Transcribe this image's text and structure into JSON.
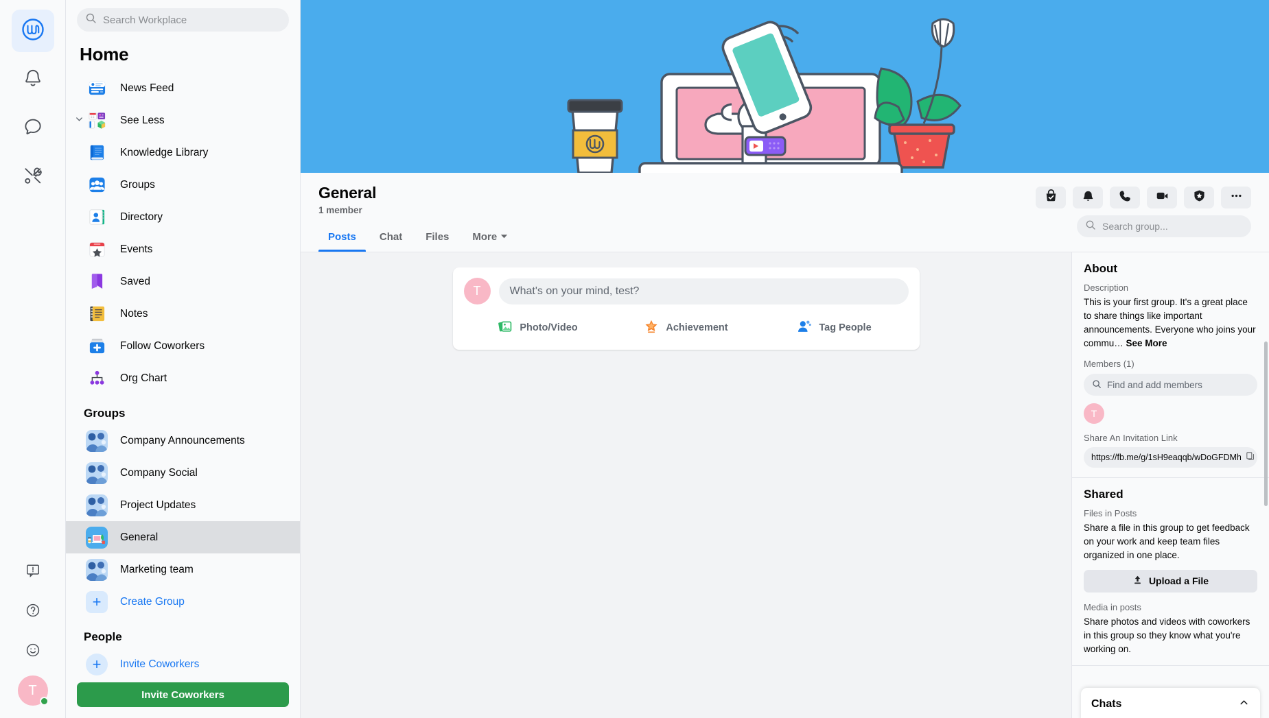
{
  "rail": {
    "items": [
      {
        "name": "workplace-home",
        "icon": "workplace-logo",
        "active": true
      },
      {
        "name": "notifications",
        "icon": "bell-icon",
        "active": false
      },
      {
        "name": "chat",
        "icon": "chat-bubble-icon",
        "active": false
      },
      {
        "name": "tools",
        "icon": "tools-icon",
        "active": false
      }
    ],
    "bottom": [
      {
        "name": "feedback",
        "icon": "feedback-icon"
      },
      {
        "name": "help",
        "icon": "help-icon"
      },
      {
        "name": "emoji",
        "icon": "smiley-icon"
      }
    ],
    "avatar_initial": "T"
  },
  "sidebar": {
    "search_placeholder": "Search Workplace",
    "title": "Home",
    "nav": [
      {
        "label": "News Feed",
        "icon": "news-feed-icon",
        "chevron": false
      },
      {
        "label": "See Less",
        "icon": "apps-grid-icon",
        "chevron": true
      },
      {
        "label": "Knowledge Library",
        "icon": "book-icon",
        "chevron": false
      },
      {
        "label": "Groups",
        "icon": "groups-icon",
        "chevron": false
      },
      {
        "label": "Directory",
        "icon": "directory-icon",
        "chevron": false
      },
      {
        "label": "Events",
        "icon": "calendar-star-icon",
        "chevron": false
      },
      {
        "label": "Saved",
        "icon": "bookmark-icon",
        "chevron": false
      },
      {
        "label": "Notes",
        "icon": "notebook-icon",
        "chevron": false
      },
      {
        "label": "Follow Coworkers",
        "icon": "follow-plus-icon",
        "chevron": false
      },
      {
        "label": "Org Chart",
        "icon": "org-chart-icon",
        "chevron": false
      }
    ],
    "groups_heading": "Groups",
    "groups": [
      {
        "label": "Company Announcements",
        "selected": false
      },
      {
        "label": "Company Social",
        "selected": false
      },
      {
        "label": "Project Updates",
        "selected": false
      },
      {
        "label": "General",
        "selected": true
      },
      {
        "label": "Marketing team",
        "selected": false
      }
    ],
    "create_group_label": "Create Group",
    "people_heading": "People",
    "invite_coworkers_link": "Invite Coworkers",
    "invite_coworkers_button": "Invite Coworkers"
  },
  "group": {
    "name": "General",
    "members_line": "1 member",
    "tabs": [
      {
        "label": "Posts",
        "active": true,
        "caret": false
      },
      {
        "label": "Chat",
        "active": false,
        "caret": false
      },
      {
        "label": "Files",
        "active": false,
        "caret": false
      },
      {
        "label": "More",
        "active": false,
        "caret": true
      }
    ],
    "actions": [
      {
        "name": "joined-button",
        "icon": "bag-check-icon"
      },
      {
        "name": "notifications-button",
        "icon": "bell-icon"
      },
      {
        "name": "audio-call-button",
        "icon": "phone-icon"
      },
      {
        "name": "video-call-button",
        "icon": "video-camera-icon"
      },
      {
        "name": "badge-button",
        "icon": "shield-star-icon"
      },
      {
        "name": "more-options-button",
        "icon": "ellipsis-icon"
      }
    ],
    "search_placeholder": "Search group..."
  },
  "composer": {
    "avatar_initial": "T",
    "placeholder": "What's on your mind, test?",
    "actions": [
      {
        "label": "Photo/Video",
        "icon": "photo-video-icon"
      },
      {
        "label": "Achievement",
        "icon": "achievement-star-icon"
      },
      {
        "label": "Tag People",
        "icon": "tag-people-icon"
      }
    ]
  },
  "about": {
    "heading": "About",
    "description_label": "Description",
    "description": "This is your first group. It's a great place to share things like important announcements. Everyone who joins your commu…",
    "see_more": "See More",
    "members_label": "Members (1)",
    "find_members_placeholder": "Find and add members",
    "member_initial": "T",
    "invite_link_label": "Share An Invitation Link",
    "invite_link": "https://fb.me/g/1sH9eaqqb/wDoGFDMh"
  },
  "shared": {
    "heading": "Shared",
    "files_label": "Files in Posts",
    "files_text": "Share a file in this group to get feedback on your work and keep team files organized in one place.",
    "upload_label": "Upload a File",
    "media_label": "Media in posts",
    "media_text": "Share photos and videos with coworkers in this group so they know what you're working on."
  },
  "chats": {
    "label": "Chats"
  },
  "colors": {
    "accent": "#1877f2",
    "cover": "#4aaced",
    "green": "#2c9b4b",
    "avatar_pink": "#f9b8c6",
    "selected_gray": "#dcdee1"
  }
}
